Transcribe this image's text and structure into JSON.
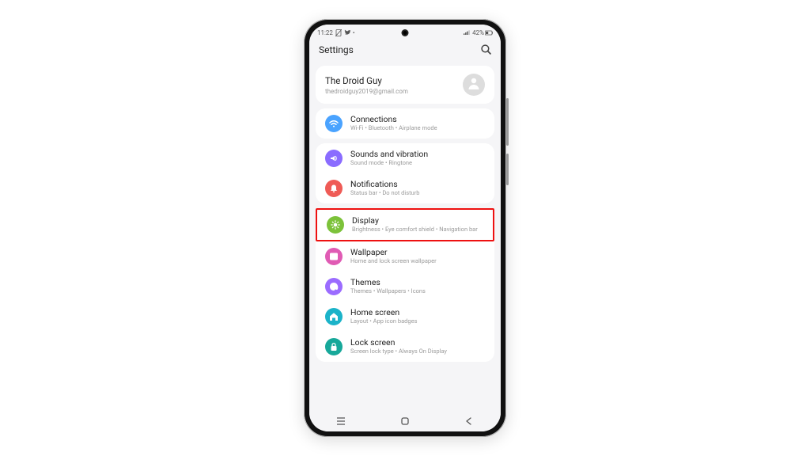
{
  "statusbar": {
    "time": "11:22",
    "left_icons": [
      "no-sim-icon",
      "bird-icon",
      "dot-icon"
    ],
    "right": {
      "signal": "signal-icon",
      "battery_pct": "42%"
    }
  },
  "header": {
    "title": "Settings"
  },
  "account": {
    "name": "The Droid Guy",
    "email": "thedroidguy2019@gmail.com"
  },
  "groups": [
    {
      "items": [
        {
          "id": "connections",
          "title": "Connections",
          "subtitle": "Wi-Fi  •  Bluetooth  •  Airplane mode",
          "icon": "wifi-icon",
          "color": "ic-blue"
        }
      ]
    },
    {
      "items": [
        {
          "id": "sounds",
          "title": "Sounds and vibration",
          "subtitle": "Sound mode  •  Ringtone",
          "icon": "volume-icon",
          "color": "ic-purple"
        },
        {
          "id": "notifications",
          "title": "Notifications",
          "subtitle": "Status bar  •  Do not disturb",
          "icon": "bell-icon",
          "color": "ic-red"
        }
      ]
    },
    {
      "items": [
        {
          "id": "display",
          "title": "Display",
          "subtitle": "Brightness  •  Eye comfort shield  •  Navigation bar",
          "icon": "sun-icon",
          "color": "ic-green",
          "highlight": true
        },
        {
          "id": "wallpaper",
          "title": "Wallpaper",
          "subtitle": "Home and lock screen wallpaper",
          "icon": "image-icon",
          "color": "ic-pink"
        },
        {
          "id": "themes",
          "title": "Themes",
          "subtitle": "Themes  •  Wallpapers  •  Icons",
          "icon": "palette-icon",
          "color": "ic-violet"
        },
        {
          "id": "home",
          "title": "Home screen",
          "subtitle": "Layout  •  App icon badges",
          "icon": "home-icon",
          "color": "ic-cyan"
        },
        {
          "id": "lock",
          "title": "Lock screen",
          "subtitle": "Screen lock type  •  Always On Display",
          "icon": "lock-icon",
          "color": "ic-teal"
        }
      ]
    }
  ],
  "nav": {
    "recents": "recents-icon",
    "home": "home-nav-icon",
    "back": "back-icon"
  }
}
